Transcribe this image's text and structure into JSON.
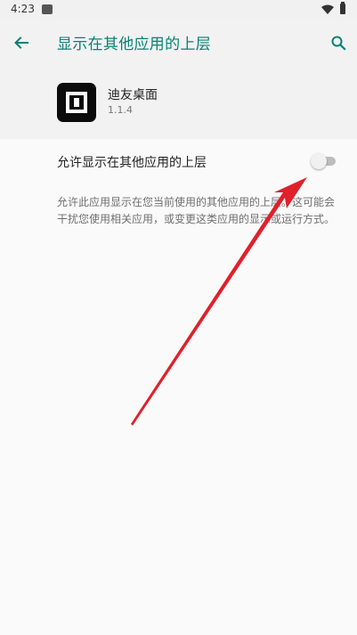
{
  "status_bar": {
    "time": "4:23",
    "notification_icon": "notification-icon",
    "wifi_icon": "wifi-icon",
    "battery_icon": "battery-icon"
  },
  "app_bar": {
    "back_icon": "arrow-back-icon",
    "title": "显示在其他应用的上层",
    "search_icon": "search-icon"
  },
  "app_info": {
    "name": "迪友桌面",
    "version": "1.1.4",
    "icon": "app-logo-icon"
  },
  "setting": {
    "label": "允许显示在其他应用的上层",
    "toggle_on": false
  },
  "description": "允许此应用显示在您当前使用的其他应用的上层。这可能会干扰您使用相关应用，或变更这类应用的显示或运行方式。",
  "colors": {
    "accent": "#0a8074",
    "annotation_arrow": "#e0202a"
  }
}
